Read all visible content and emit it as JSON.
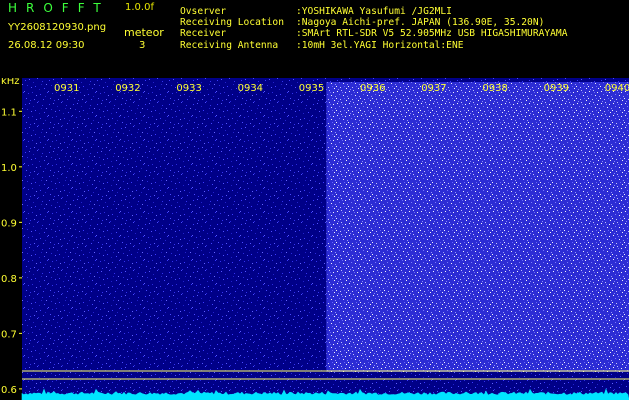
{
  "header": {
    "app_title": "HROFFT",
    "version": "1.0.0f",
    "filename": "YY2608120930.png",
    "datetime": "26.08.12 09:30",
    "meteor_label": "meteor",
    "meteor_count": "3"
  },
  "info": [
    {
      "label": "Ovserver",
      "value": ":YOSHIKAWA Yasufumi /JG2MLI"
    },
    {
      "label": "Receiving Location",
      "value": ":Nagoya Aichi-pref. JAPAN (136.90E, 35.20N)"
    },
    {
      "label": "Receiver",
      "value": ":SMArt RTL-SDR V5 52.905MHz USB HIGASHIMURAYAMA"
    },
    {
      "label": "Receiving Antenna",
      "value": ":10mH 3el.YAGI Horizontal:ENE"
    }
  ],
  "spectrogram": {
    "unit_label": "kHz",
    "time_labels": [
      "0931",
      "0932",
      "0933",
      "0934",
      "0935",
      "0936",
      "0937",
      "0938",
      "0939",
      "0940"
    ],
    "freq_labels": [
      "1.1",
      "1.0",
      "0.9",
      "0.8",
      "0.7",
      "0.6"
    ],
    "freq_values": [
      1.1,
      1.0,
      0.9,
      0.8,
      0.7,
      0.6
    ],
    "freq_range": [
      0.58,
      1.16
    ],
    "bright_band_minutes": [
      0.4,
      5.9
    ],
    "colors": {
      "background": "#000088",
      "noise": "#3a3aff",
      "bright": "#ffffff",
      "trace": "#00e5ff",
      "text": "#ffff33",
      "marker": "#ffff66"
    }
  }
}
